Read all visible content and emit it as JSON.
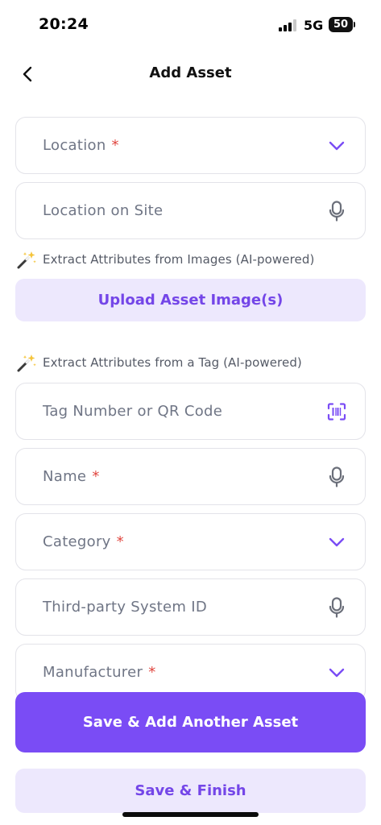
{
  "status_bar": {
    "time": "20:24",
    "network": "5G",
    "battery": "50"
  },
  "nav": {
    "title": "Add Asset",
    "back_icon": "chevron-left-icon"
  },
  "form": {
    "location": {
      "label": "Location",
      "required": "*",
      "icon": "chevron-down-icon"
    },
    "location_on_site": {
      "label": "Location on Site",
      "icon": "microphone-icon"
    },
    "extract_images_hint": "Extract Attributes from Images (AI-powered)",
    "upload_button": "Upload Asset Image(s)",
    "extract_tag_hint": "Extract Attributes from a Tag (AI-powered)",
    "tag_number": {
      "label": "Tag Number or QR Code",
      "icon": "qr-scan-icon"
    },
    "name": {
      "label": "Name",
      "required": "*",
      "icon": "microphone-icon"
    },
    "category": {
      "label": "Category",
      "required": "*",
      "icon": "chevron-down-icon"
    },
    "third_party_id": {
      "label": "Third-party System ID",
      "icon": "microphone-icon"
    },
    "manufacturer": {
      "label": "Manufacturer",
      "required": "*",
      "icon": "chevron-down-icon"
    }
  },
  "actions": {
    "save_add_another": "Save & Add Another Asset",
    "save_finish": "Save & Finish"
  },
  "colors": {
    "accent": "#7a4cf5",
    "accent_light": "#ede8fd",
    "accent_text": "#7446e8",
    "required": "#e0463f",
    "placeholder": "#6f7585",
    "border": "#e3e3e9"
  }
}
